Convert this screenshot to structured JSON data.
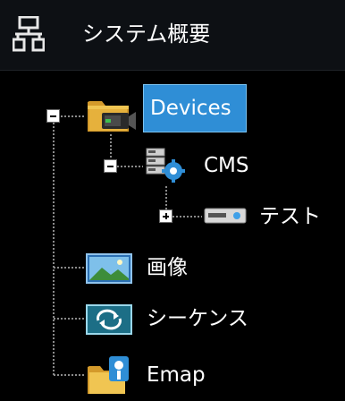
{
  "header": {
    "title": "システム概要",
    "icon": "network-icon"
  },
  "tree": {
    "root": {
      "label": "Devices",
      "icon": "folder-camera-icon",
      "expanded": true,
      "selected": true,
      "children": {
        "cms": {
          "label": "CMS",
          "icon": "server-settings-icon",
          "expanded": true,
          "children": {
            "test": {
              "label": "テスト",
              "icon": "recorder-device-icon",
              "expanded": false
            }
          }
        }
      }
    },
    "image": {
      "label": "画像",
      "icon": "picture-icon"
    },
    "sequence": {
      "label": "シーケンス",
      "icon": "sequence-icon"
    },
    "emap": {
      "label": "Emap",
      "icon": "emap-icon"
    }
  },
  "colors": {
    "background": "#000000",
    "selection": "#2f8ed6",
    "text": "#ffffff"
  }
}
